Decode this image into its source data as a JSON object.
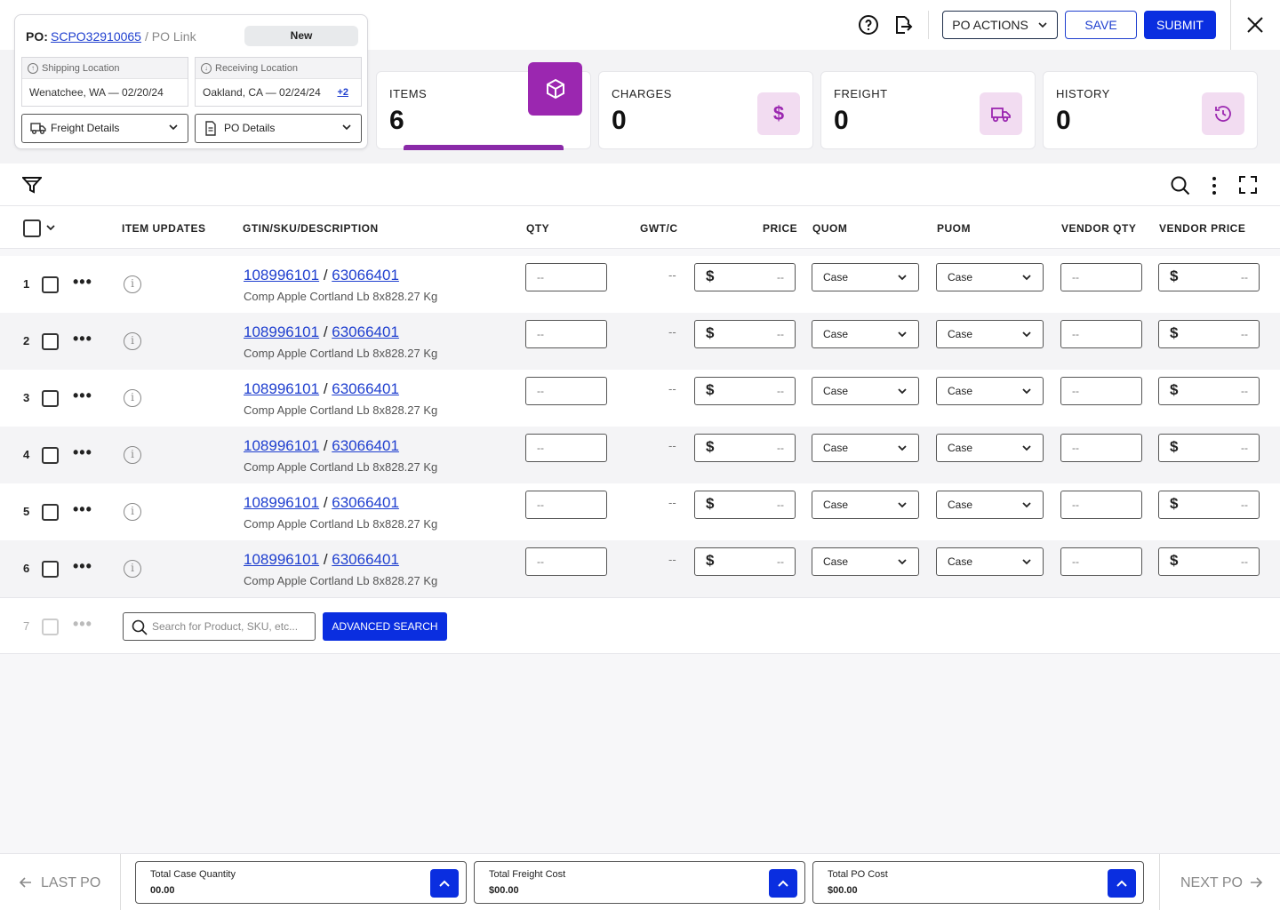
{
  "po": {
    "label": "PO:",
    "number": "SCPO32910065",
    "link_text": "/ PO Link",
    "status": "New",
    "shipping_label": "Shipping Location",
    "shipping_value": "Wenatchee, WA — 02/20/24",
    "receiving_label": "Receiving Location",
    "receiving_value": "Oakland, CA — 02/24/24",
    "receiving_more": "+2",
    "freight_details": "Freight Details",
    "po_details": "PO Details"
  },
  "stats": [
    {
      "label": "ITEMS",
      "value": "6",
      "icon": "cube-icon"
    },
    {
      "label": "CHARGES",
      "value": "0",
      "icon": "dollar-icon"
    },
    {
      "label": "FREIGHT",
      "value": "0",
      "icon": "truck-icon"
    },
    {
      "label": "HISTORY",
      "value": "0",
      "icon": "history-icon"
    }
  ],
  "actions": {
    "po_actions": "PO ACTIONS",
    "save": "SAVE",
    "submit": "SUBMIT"
  },
  "table": {
    "headers": {
      "item_updates": "ITEM UPDATES",
      "gtin": "GTIN/SKU/DESCRIPTION",
      "qty": "QTY",
      "gwt": "GWT/C",
      "price": "PRICE",
      "quom": "QUOM",
      "puom": "PUOM",
      "vendor_qty": "VENDOR QTY",
      "vendor_price": "VENDOR PRICE"
    },
    "rows": [
      {
        "num": "1",
        "gtin": "108996101",
        "sku": "63066401",
        "desc": "Comp Apple Cortland Lb 8x828.27 Kg",
        "qty": "--",
        "gwt": "--",
        "price": "--",
        "quom": "Case",
        "puom": "Case",
        "vendor_qty": "--",
        "vendor_price": "--"
      },
      {
        "num": "2",
        "gtin": "108996101",
        "sku": "63066401",
        "desc": "Comp Apple Cortland Lb 8x828.27 Kg",
        "qty": "--",
        "gwt": "--",
        "price": "--",
        "quom": "Case",
        "puom": "Case",
        "vendor_qty": "--",
        "vendor_price": "--"
      },
      {
        "num": "3",
        "gtin": "108996101",
        "sku": "63066401",
        "desc": "Comp Apple Cortland Lb 8x828.27 Kg",
        "qty": "--",
        "gwt": "--",
        "price": "--",
        "quom": "Case",
        "puom": "Case",
        "vendor_qty": "--",
        "vendor_price": "--"
      },
      {
        "num": "4",
        "gtin": "108996101",
        "sku": "63066401",
        "desc": "Comp Apple Cortland Lb 8x828.27 Kg",
        "qty": "--",
        "gwt": "--",
        "price": "--",
        "quom": "Case",
        "puom": "Case",
        "vendor_qty": "--",
        "vendor_price": "--"
      },
      {
        "num": "5",
        "gtin": "108996101",
        "sku": "63066401",
        "desc": "Comp Apple Cortland Lb 8x828.27 Kg",
        "qty": "--",
        "gwt": "--",
        "price": "--",
        "quom": "Case",
        "puom": "Case",
        "vendor_qty": "--",
        "vendor_price": "--"
      },
      {
        "num": "6",
        "gtin": "108996101",
        "sku": "63066401",
        "desc": "Comp Apple Cortland Lb 8x828.27 Kg",
        "qty": "--",
        "gwt": "--",
        "price": "--",
        "quom": "Case",
        "puom": "Case",
        "vendor_qty": "--",
        "vendor_price": "--"
      }
    ],
    "new_row_num": "7",
    "search_placeholder": "Search for Product, SKU, etc...",
    "advanced_search": "ADVANCED SEARCH"
  },
  "footer": {
    "last_po": "LAST PO",
    "next_po": "NEXT PO",
    "totals": [
      {
        "label": "Total Case Quantity",
        "value": "00.00"
      },
      {
        "label": "Total Freight Cost",
        "value": "$00.00"
      },
      {
        "label": "Total PO Cost",
        "value": "$00.00"
      }
    ]
  },
  "colors": {
    "primary": "#0a2ee0",
    "accent": "#9b27b0",
    "accent_light": "#f2dcf1"
  }
}
